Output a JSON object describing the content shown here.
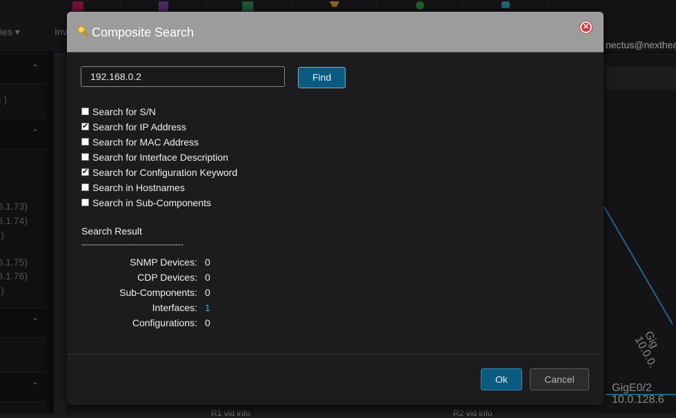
{
  "background": {
    "nav_left_label": "ies",
    "nav_inventory_label": "Inv",
    "user_label": "nectus@nexthea",
    "sidebar_values": [
      "s )",
      "6.1.73)",
      "6.1.74)",
      ")",
      "6.1.75)",
      "6.1.76)",
      ")"
    ],
    "diagram": {
      "port_label": "GigE0/2",
      "ip_label": "10.0.128.6",
      "rotated_label_1": "Gig",
      "rotated_label_2": "10.0.0.",
      "bottom_left_text": "R1 vid info",
      "bottom_right_text": "R2 vid info"
    }
  },
  "modal": {
    "title": "Composite Search",
    "search": {
      "value": "192.168.0.2",
      "find_label": "Find"
    },
    "options": [
      {
        "label": "Search for S/N",
        "checked": false
      },
      {
        "label": "Search for IP Address",
        "checked": true
      },
      {
        "label": "Search for MAC Address",
        "checked": false
      },
      {
        "label": "Search for Interface Description",
        "checked": false
      },
      {
        "label": "Search for Configuration Keyword",
        "checked": true
      },
      {
        "label": "Search in Hostnames",
        "checked": false
      },
      {
        "label": "Search in Sub-Components",
        "checked": false
      }
    ],
    "results": {
      "title": "Search Result",
      "separator": "-------------------------------------",
      "rows": [
        {
          "label": "SNMP Devices:",
          "value": "0"
        },
        {
          "label": "CDP Devices:",
          "value": "0"
        },
        {
          "label": "Sub-Components:",
          "value": "0"
        },
        {
          "label": "Interfaces:",
          "value": "1"
        },
        {
          "label": "Configurations:",
          "value": "0"
        }
      ]
    },
    "ok_label": "Ok",
    "cancel_label": "Cancel"
  },
  "colors": {
    "accent": "#0b5a80",
    "link": "#36a7d6",
    "header": "#9c9c9c"
  }
}
